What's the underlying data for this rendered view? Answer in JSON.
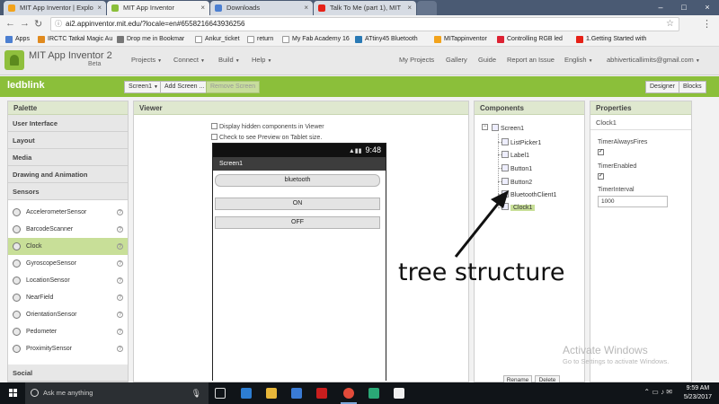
{
  "browser": {
    "tabs": [
      {
        "title": "MIT App Inventor | Explo",
        "color": "#f2a31c"
      },
      {
        "title": "MIT App Inventor",
        "color": "#8bbf3a"
      },
      {
        "title": "Downloads",
        "color": "#4c7fd1"
      },
      {
        "title": "Talk To Me (part 1), MIT",
        "color": "#e62117"
      }
    ],
    "url": "ai2.appinventor.mit.edu/?locale=en#6558216643936256",
    "bookmarks": [
      {
        "label": "Apps",
        "color": "#4c7fd1"
      },
      {
        "label": "IRCTC Tatkal Magic Au",
        "color": "#e08a1e"
      },
      {
        "label": "Drop me in Bookmar",
        "color": "#777777"
      },
      {
        "label": "Ankur_ticket",
        "color": "#ffffff"
      },
      {
        "label": "return",
        "color": "#ffffff"
      },
      {
        "label": "My Fab Academy 16",
        "color": "#ffffff"
      },
      {
        "label": "ATtiny45 Bluetooth",
        "color": "#2a7ab5"
      },
      {
        "label": "MITappinventor",
        "color": "#f2a31c"
      },
      {
        "label": "Controlling RGB led",
        "color": "#d23"
      },
      {
        "label": "1.Getting Started with",
        "color": "#e62117"
      }
    ]
  },
  "app": {
    "title": "MIT App Inventor 2",
    "beta": "Beta",
    "menus": [
      "Projects",
      "Connect",
      "Build",
      "Help"
    ],
    "links": [
      "My Projects",
      "Gallery",
      "Guide",
      "Report an Issue",
      "English"
    ],
    "account": "abhiverticallimits@gmail.com"
  },
  "project": {
    "name": "ledblink",
    "screen_select": "Screen1",
    "add_screen": "Add Screen ...",
    "remove_screen": "Remove Screen",
    "designer": "Designer",
    "blocks": "Blocks"
  },
  "palette": {
    "title": "Palette",
    "categories": [
      "User Interface",
      "Layout",
      "Media",
      "Drawing and Animation",
      "Sensors"
    ],
    "sensors": [
      "AccelerometerSensor",
      "BarcodeScanner",
      "Clock",
      "GyroscopeSensor",
      "LocationSensor",
      "NearField",
      "OrientationSensor",
      "Pedometer",
      "ProximitySensor"
    ],
    "selected": "Clock",
    "next_category": "Social",
    "help_glyph": "?"
  },
  "viewer": {
    "title": "Viewer",
    "hidden_components": "Display hidden components in Viewer",
    "tablet_preview": "Check to see Preview on Tablet size.",
    "time": "9:48",
    "screen_title": "Screen1",
    "buttons": [
      "bluetooth",
      "ON",
      "OFF"
    ]
  },
  "components": {
    "title": "Components",
    "root": "Screen1",
    "children": [
      "ListPicker1",
      "Label1",
      "Button1",
      "Button2",
      "BluetoothClient1",
      "Clock1"
    ],
    "rename": "Rename",
    "delete": "Delete"
  },
  "properties": {
    "title": "Properties",
    "component": "Clock1",
    "timer_always_fires": "TimerAlwaysFires",
    "timer_enabled": "TimerEnabled",
    "timer_interval": "TimerInterval",
    "timer_interval_value": "1000"
  },
  "annotation": "tree structure",
  "watermark": {
    "line1": "Activate Windows",
    "line2": "Go to Settings to activate Windows."
  },
  "taskbar": {
    "search_placeholder": "Ask me anything",
    "time": "9:59 AM",
    "date": "5/23/2017"
  }
}
